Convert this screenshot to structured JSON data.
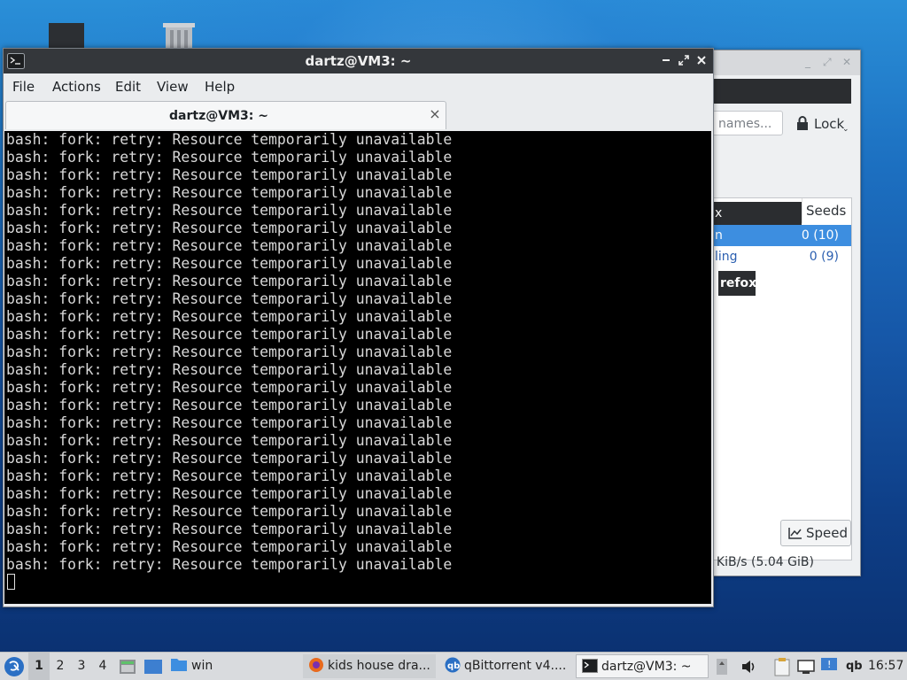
{
  "colors": {
    "terminal_bg": "#000000",
    "terminal_fg": "#d8d8d8",
    "titlebar_bg": "#34373b",
    "selection_blue": "#3d8ee0",
    "taskbar_bg": "#d9dbde"
  },
  "terminal": {
    "window_title": "dartz@VM3: ~",
    "menu": {
      "file": "File",
      "actions": "Actions",
      "edit": "Edit",
      "view": "View",
      "help": "Help"
    },
    "tab_label": "dartz@VM3: ~",
    "output_lines": [
      "bash: fork: retry: Resource temporarily unavailable",
      "bash: fork: retry: Resource temporarily unavailable",
      "bash: fork: retry: Resource temporarily unavailable",
      "bash: fork: retry: Resource temporarily unavailable",
      "bash: fork: retry: Resource temporarily unavailable",
      "bash: fork: retry: Resource temporarily unavailable",
      "bash: fork: retry: Resource temporarily unavailable",
      "bash: fork: retry: Resource temporarily unavailable",
      "bash: fork: retry: Resource temporarily unavailable",
      "bash: fork: retry: Resource temporarily unavailable",
      "bash: fork: retry: Resource temporarily unavailable",
      "bash: fork: retry: Resource temporarily unavailable",
      "bash: fork: retry: Resource temporarily unavailable",
      "bash: fork: retry: Resource temporarily unavailable",
      "bash: fork: retry: Resource temporarily unavailable",
      "bash: fork: retry: Resource temporarily unavailable",
      "bash: fork: retry: Resource temporarily unavailable",
      "bash: fork: retry: Resource temporarily unavailable",
      "bash: fork: retry: Resource temporarily unavailable",
      "bash: fork: retry: Resource temporarily unavailable",
      "bash: fork: retry: Resource temporarily unavailable",
      "bash: fork: retry: Resource temporarily unavailable",
      "bash: fork: retry: Resource temporarily unavailable",
      "bash: fork: retry: Resource temporarily unavailable",
      "bash: fork: retry: Resource temporarily unavailable"
    ]
  },
  "qbittorrent": {
    "filter_placeholder": "names...",
    "lock_label": "Lock",
    "column_name": "x",
    "column_seeds": "Seeds",
    "rows": [
      {
        "name": "n",
        "seeds": "0 (10)"
      },
      {
        "name": "ling",
        "seeds": "0 (9)"
      }
    ],
    "tooltip": "refox",
    "speed_button": "Speed",
    "status": ") KiB/s (5.04 GiB)"
  },
  "taskbar": {
    "workspaces": [
      "1",
      "2",
      "3",
      "4"
    ],
    "active_workspace": "1",
    "folder_label": "win",
    "tasks": [
      {
        "label": "kids house dra...",
        "icon": "firefox-icon"
      },
      {
        "label": "qBittorrent v4....",
        "icon": "qbittorrent-icon"
      },
      {
        "label": "dartz@VM3: ~",
        "icon": "terminal-icon"
      }
    ],
    "tray_qb_label": "qb",
    "clock": "16:57"
  }
}
